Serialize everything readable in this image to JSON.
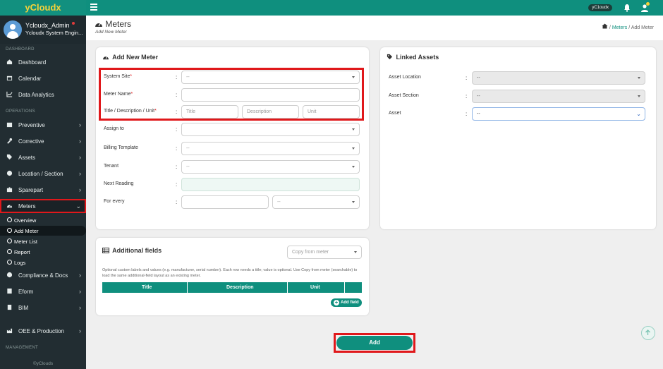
{
  "app": {
    "logo": "yCloudx",
    "top_user_badge": "yC1oudx"
  },
  "profile": {
    "name": "Ycloudx_Admin",
    "role": "Ycloudx System Engin..."
  },
  "sidebar": {
    "section_dashboard": "DASHBOARD",
    "section_operations": "OPERATIONS",
    "section_management": "MANAGEMENT",
    "items": [
      {
        "label": "Dashboard",
        "icon": "dashboard-icon"
      },
      {
        "label": "Calendar",
        "icon": "calendar-icon"
      },
      {
        "label": "Data Analytics",
        "icon": "chart-icon"
      },
      {
        "label": "Preventive",
        "icon": "calendar-check-icon"
      },
      {
        "label": "Corrective",
        "icon": "wrench-icon"
      },
      {
        "label": "Assets",
        "icon": "tag-icon"
      },
      {
        "label": "Location / Section",
        "icon": "globe-icon"
      },
      {
        "label": "Sparepart",
        "icon": "puzzle-icon"
      },
      {
        "label": "Meters",
        "icon": "gauge-icon"
      },
      {
        "label": "Compliance & Docs",
        "icon": "shield-icon"
      },
      {
        "label": "Eform",
        "icon": "form-icon"
      },
      {
        "label": "BIM",
        "icon": "building-icon"
      },
      {
        "label": "OEE & Production",
        "icon": "production-icon"
      }
    ],
    "sub_items": [
      "Overview",
      "Add Meter",
      "Meter List",
      "Report",
      "Logs"
    ],
    "footer": "©yClouds"
  },
  "header": {
    "title": "Meters",
    "subtitle": "Add New Meter",
    "breadcrumb": {
      "link": "Meters",
      "sep": "/",
      "current": "Add Meter"
    }
  },
  "add_meter": {
    "title": "Add New Meter",
    "system_site": {
      "label": "System Site",
      "value": "--"
    },
    "meter_name": {
      "label": "Meter Name",
      "value": ""
    },
    "title_desc_unit": {
      "label": "Title / Description / Unit",
      "title_ph": "Title",
      "desc_ph": "Description",
      "unit_ph": "Unit"
    },
    "assign_to": {
      "label": "Assign to",
      "value": ""
    },
    "billing_template": {
      "label": "Billing Template",
      "value": "--"
    },
    "tenant": {
      "label": "Tenant",
      "value": "--"
    },
    "next_reading": {
      "label": "Next Reading",
      "value": ""
    },
    "for_every": {
      "label": "For every",
      "value": "",
      "unit": "--"
    },
    "colon": ":",
    "req": "*"
  },
  "linked_assets": {
    "title": "Linked Assets",
    "asset_location": {
      "label": "Asset Location",
      "value": "--"
    },
    "asset_section": {
      "label": "Asset Section",
      "value": "--"
    },
    "asset": {
      "label": "Asset",
      "value": "--"
    }
  },
  "additional_fields": {
    "title": "Additional fields",
    "copy_from": "Copy from meter",
    "help": "Optional custom labels and values (e.g. manufacturer, serial number). Each row needs a title; value is optional. Use Copy from meter (searchable) to load the same additional-field layout as an existing meter.",
    "columns": [
      "Title",
      "Description",
      "Unit"
    ],
    "add_field": "Add field"
  },
  "actions": {
    "add": "Add"
  },
  "colors": {
    "brand": "#0f8f7e",
    "sidebar": "#222d32",
    "highlight": "#e0181b",
    "logo_text": "#f5d23a"
  }
}
